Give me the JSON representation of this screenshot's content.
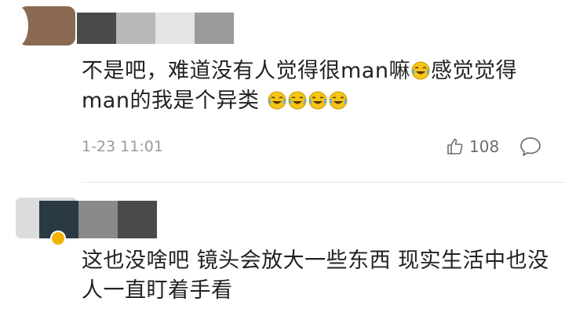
{
  "comments": [
    {
      "text_before_emoji": "不是吧，难道没有人觉得很man嘛",
      "text_after_emoji": "感觉觉得man的我是个异类",
      "inline_emoji": "laughing-crying-emoji",
      "trailing_emojis": [
        "laughing-crying-emoji",
        "laughing-crying-emoji",
        "laughing-crying-emoji",
        "laughing-crying-emoji"
      ],
      "timestamp": "1-23 11:01",
      "like_count": "108",
      "avatar_colors": [
        "#8a6a52"
      ],
      "mosaic_colors": [
        "#4a4a4a",
        "#b8b8b8",
        "#e4e4e4",
        "#9a9a9a"
      ]
    },
    {
      "text": "这也没啥吧 镜头会放大一些东西 现实生活中也没人一直盯着手看",
      "avatar_colors": [
        "#1f2f3a"
      ],
      "mosaic_colors": [
        "#2a3a44",
        "#8a8a8a",
        "#4a4a4a"
      ]
    }
  ],
  "icons": {
    "like": "thumbs-up-icon",
    "reply": "speech-bubble-icon",
    "verified_badge": "gold-badge-icon"
  },
  "colors": {
    "text_primary": "#222222",
    "text_secondary": "#9a9a9a",
    "divider": "#e8e8e8",
    "emoji_yellow": "#f5c518"
  }
}
